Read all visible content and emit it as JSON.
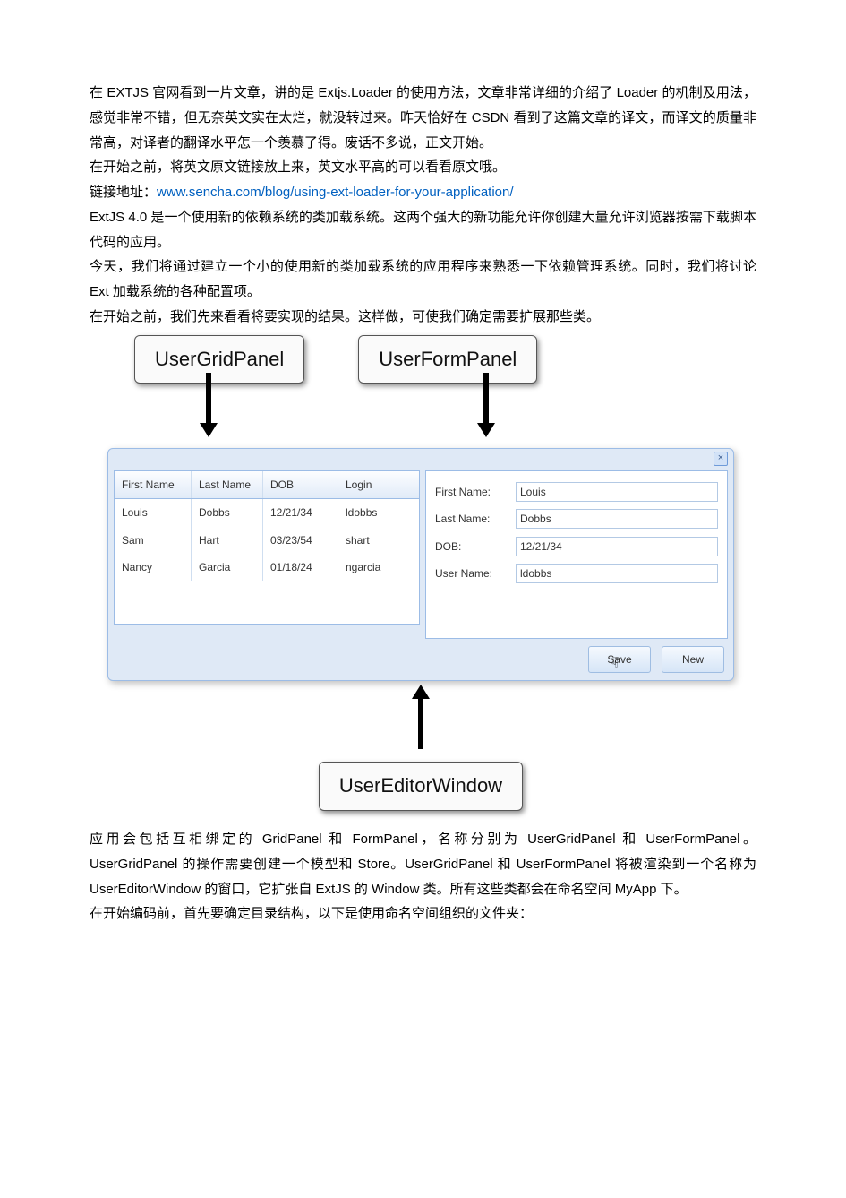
{
  "para1": "在 EXTJS 官网看到一片文章，讲的是 Extjs.Loader 的使用方法，文章非常详细的介绍了 Loader 的机制及用法，感觉非常不错，但无奈英文实在太烂，就没转过来。昨天恰好在 CSDN 看到了这篇文章的译文，而译文的质量非常高，对译者的翻译水平怎一个羡慕了得。废话不多说，正文开始。",
  "para2": "在开始之前，将英文原文链接放上来，英文水平高的可以看看原文哦。",
  "link_label_prefix": "链接地址：",
  "link_url": "www.sencha.com/blog/using-ext-loader-for-your-application/",
  "para3": "ExtJS 4.0 是一个使用新的依赖系统的类加载系统。这两个强大的新功能允许你创建大量允许浏览器按需下载脚本代码的应用。",
  "para4": "今天，我们将通过建立一个小的使用新的类加载系统的应用程序来熟悉一下依赖管理系统。同时，我们将讨论 Ext 加载系统的各种配置项。",
  "para5": "在开始之前，我们先来看看将要实现的结果。这样做，可使我们确定需要扩展那些类。",
  "para6": "应用会包括互相绑定的 GridPanel 和 FormPanel，名称分别为 UserGridPanel 和 UserFormPanel。UserGridPanel 的操作需要创建一个模型和 Store。UserGridPanel 和 UserFormPanel 将被渲染到一个名称为 UserEditorWindow 的窗口，它扩张自 ExtJS 的 Window 类。所有这些类都会在命名空间 MyApp 下。",
  "para7": "在开始编码前，首先要确定目录结构，以下是使用命名空间组织的文件夹：",
  "callouts": {
    "grid": "UserGridPanel",
    "form": "UserFormPanel",
    "window": "UserEditorWindow"
  },
  "grid": {
    "headers": [
      "First Name",
      "Last Name",
      "DOB",
      "Login"
    ],
    "rows": [
      [
        "Louis",
        "Dobbs",
        "12/21/34",
        "ldobbs"
      ],
      [
        "Sam",
        "Hart",
        "03/23/54",
        "shart"
      ],
      [
        "Nancy",
        "Garcia",
        "01/18/24",
        "ngarcia"
      ]
    ]
  },
  "form": {
    "labels": [
      "First Name:",
      "Last Name:",
      "DOB:",
      "User Name:"
    ],
    "values": [
      "Louis",
      "Dobbs",
      "12/21/34",
      "ldobbs"
    ]
  },
  "buttons": {
    "save": "Save",
    "new": "New"
  },
  "close_icon": "×"
}
